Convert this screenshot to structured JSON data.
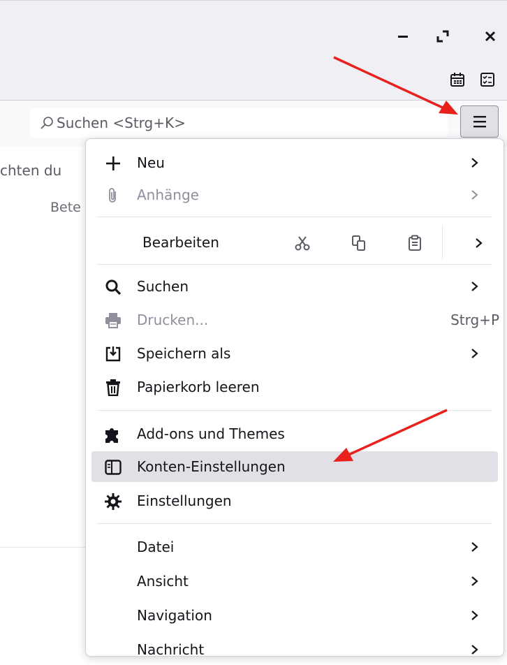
{
  "search": {
    "placeholder": "Suchen <Strg+K>"
  },
  "background": {
    "text1": "chten du",
    "text2": "Bete"
  },
  "app_menu": {
    "new": {
      "label": "Neu"
    },
    "attachments": {
      "label": "Anhänge"
    },
    "edit": {
      "label": "Bearbeiten"
    },
    "find": {
      "label": "Suchen"
    },
    "print": {
      "label": "Drucken...",
      "shortcut": "Strg+P"
    },
    "save_as": {
      "label": "Speichern als"
    },
    "empty_trash": {
      "label": "Papierkorb leeren"
    },
    "addons": {
      "label": "Add-ons und Themes"
    },
    "account_settings": {
      "label": "Konten-Einstellungen"
    },
    "settings": {
      "label": "Einstellungen"
    },
    "file": {
      "label": "Datei"
    },
    "view": {
      "label": "Ansicht"
    },
    "navigation": {
      "label": "Navigation"
    },
    "message": {
      "label": "Nachricht"
    }
  },
  "colors": {
    "annotation_arrow": "#e8211d",
    "highlight": "#e0e0e6"
  }
}
